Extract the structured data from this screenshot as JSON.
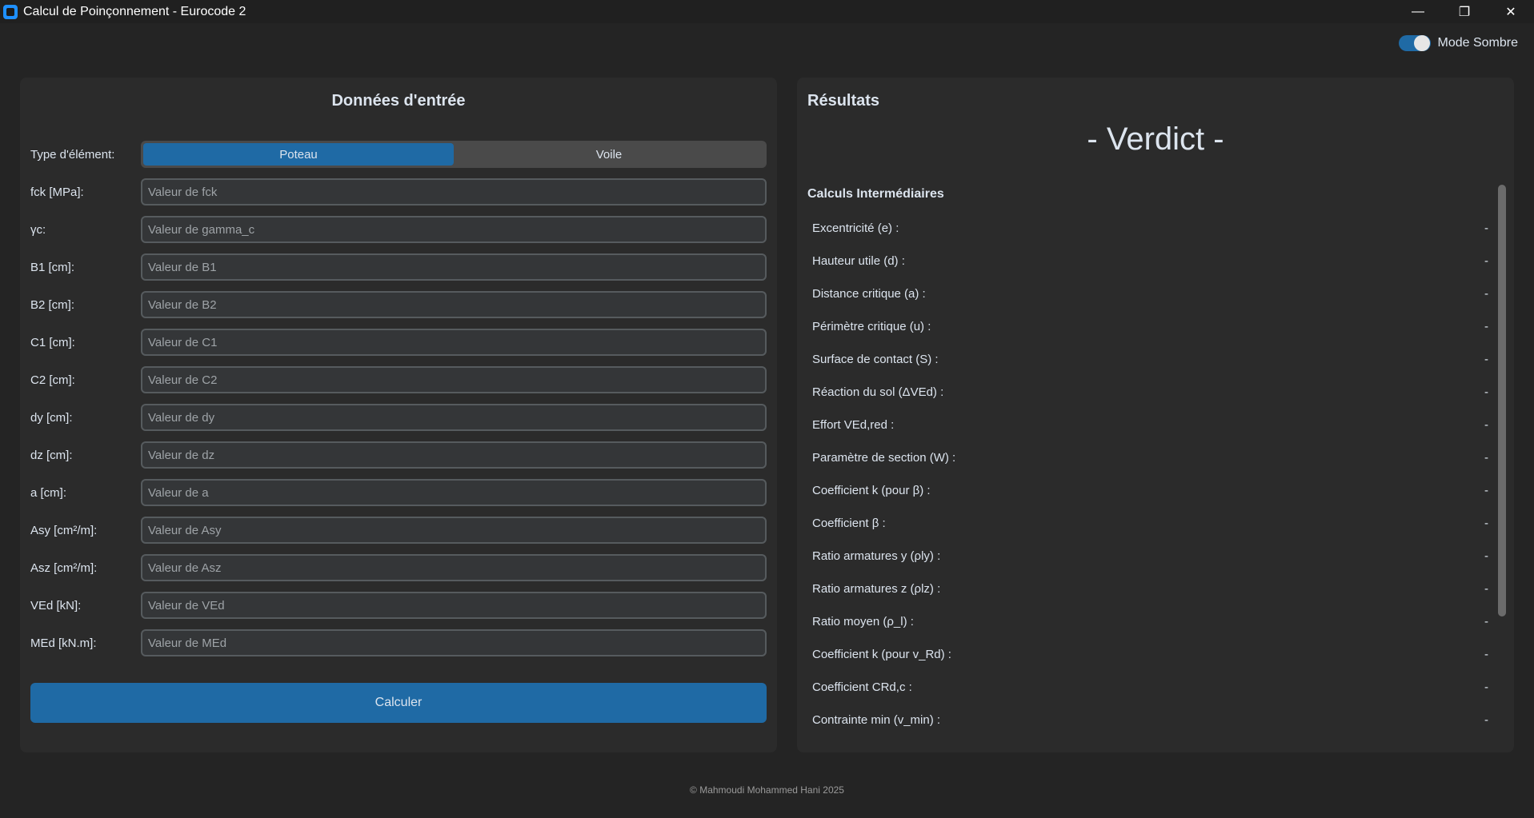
{
  "window": {
    "title": "Calcul de Poinçonnement - Eurocode 2",
    "controls": {
      "minimize": "—",
      "restore": "❐",
      "close": "✕"
    }
  },
  "theme_toggle": {
    "label": "Mode Sombre",
    "on": true
  },
  "input_panel": {
    "title": "Données d'entrée",
    "element_type": {
      "label": "Type d'élément:",
      "options": [
        "Poteau",
        "Voile"
      ],
      "selected": "Poteau"
    },
    "fields": [
      {
        "label": "fck [MPa]:",
        "placeholder": "Valeur de fck"
      },
      {
        "label": "γc:",
        "placeholder": "Valeur de gamma_c"
      },
      {
        "label": "B1 [cm]:",
        "placeholder": "Valeur de B1"
      },
      {
        "label": "B2 [cm]:",
        "placeholder": "Valeur de B2"
      },
      {
        "label": "C1 [cm]:",
        "placeholder": "Valeur de C1"
      },
      {
        "label": "C2 [cm]:",
        "placeholder": "Valeur de C2"
      },
      {
        "label": "dy [cm]:",
        "placeholder": "Valeur de dy"
      },
      {
        "label": "dz [cm]:",
        "placeholder": "Valeur de dz"
      },
      {
        "label": "a [cm]:",
        "placeholder": "Valeur de a"
      },
      {
        "label": "Asy [cm²/m]:",
        "placeholder": "Valeur de Asy"
      },
      {
        "label": "Asz [cm²/m]:",
        "placeholder": "Valeur de Asz"
      },
      {
        "label": "VEd [kN]:",
        "placeholder": "Valeur de VEd"
      },
      {
        "label": "MEd [kN.m]:",
        "placeholder": "Valeur de MEd"
      }
    ],
    "calculate_label": "Calculer"
  },
  "results_panel": {
    "title": "Résultats",
    "verdict": "- Verdict -",
    "section_title": "Calculs Intermédiaires",
    "rows": [
      {
        "label": "Excentricité (e) :",
        "value": "-"
      },
      {
        "label": "Hauteur utile (d) :",
        "value": "-"
      },
      {
        "label": "Distance critique (a) :",
        "value": "-"
      },
      {
        "label": "Périmètre critique (u) :",
        "value": "-"
      },
      {
        "label": "Surface de contact (S) :",
        "value": "-"
      },
      {
        "label": "Réaction du sol (ΔVEd) :",
        "value": "-"
      },
      {
        "label": "Effort VEd,red :",
        "value": "-"
      },
      {
        "label": "Paramètre de section (W) :",
        "value": "-"
      },
      {
        "label": "Coefficient k (pour β) :",
        "value": "-"
      },
      {
        "label": "Coefficient β :",
        "value": "-"
      },
      {
        "label": "Ratio armatures y (ρly) :",
        "value": "-"
      },
      {
        "label": "Ratio armatures z (ρlz) :",
        "value": "-"
      },
      {
        "label": "Ratio moyen (ρ_l) :",
        "value": "-"
      },
      {
        "label": "Coefficient k (pour v_Rd) :",
        "value": "-"
      },
      {
        "label": "Coefficient CRd,c :",
        "value": "-"
      },
      {
        "label": "Contrainte min (v_min) :",
        "value": "-"
      }
    ]
  },
  "footer": "© Mahmoudi Mohammed Hani 2025"
}
